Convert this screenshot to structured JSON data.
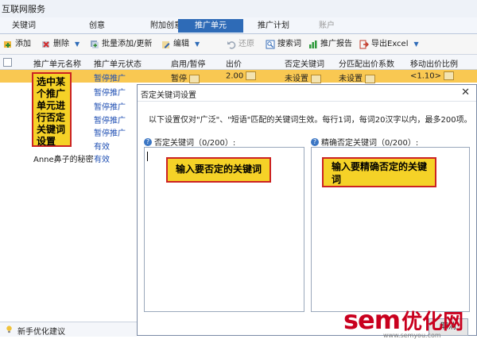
{
  "window": {
    "title": "互联网服务"
  },
  "tabs": [
    {
      "label": "关键词"
    },
    {
      "label": "创意"
    },
    {
      "label": "附加创意"
    },
    {
      "label": "推广单元"
    },
    {
      "label": "推广计划"
    },
    {
      "label": "账户"
    }
  ],
  "toolbar": {
    "add": "添加",
    "delete": "删除",
    "batch": "批量添加/更新",
    "edit": "编辑",
    "restore": "还原",
    "search_word": "搜索词",
    "report": "推广报告",
    "export": "导出Excel"
  },
  "columns": [
    "推广单元名称",
    "推广单元状态",
    "启用/暂停",
    "出价",
    "否定关键词",
    "分匹配出价系数",
    "移动出价比例"
  ],
  "rows": [
    {
      "name": "",
      "status": "暂停推广",
      "enabled": "暂停",
      "bid": "2.00",
      "negative": "未设置",
      "coef": "未设置",
      "mobile": "<1.10>"
    },
    {
      "name": "",
      "status": "暂停推广"
    },
    {
      "name": "",
      "status": "暂停推广"
    },
    {
      "name": "",
      "status": "暂停推广"
    },
    {
      "name": "",
      "status": "暂停推广"
    },
    {
      "name": "",
      "status": "有效"
    },
    {
      "name": "Anne鼻子的秘密",
      "status": "有效"
    }
  ],
  "callout_main": "选中某个推广单元进行否定关键词设置",
  "dialog": {
    "title": "否定关键词设置",
    "description": "以下设置仅对\"广泛\"、\"短语\"匹配的关键词生效。每行1词，每词20汉字以内，最多200项。",
    "negative_label": "否定关键词（0/200）:",
    "exact_label": "精确否定关键词（0/200）:",
    "negative_hint": "输入要否定的关键词",
    "exact_hint": "输入要精确否定的关键词",
    "cancel": "取消"
  },
  "footer": {
    "text": "新手优化建议"
  },
  "watermark": {
    "brand_latin": "sem",
    "brand_cn": "优化网",
    "url": "www.semyou.com"
  }
}
